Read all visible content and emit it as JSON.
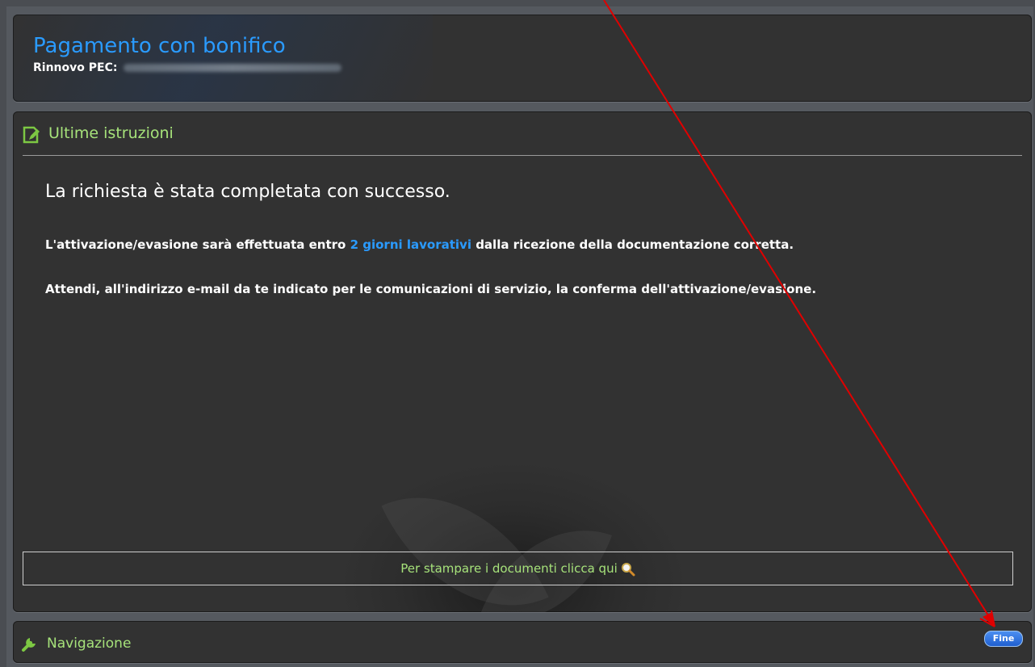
{
  "header": {
    "title": "Pagamento con bonifico",
    "subtitle_label": "Rinnovo PEC:"
  },
  "main": {
    "section_title": "Ultime istruzioni",
    "message_title": "La richiesta è stata completata con successo.",
    "line1_before": "L'attivazione/evasione sarà effettuata entro ",
    "line1_highlight": "2 giorni lavorativi",
    "line1_after": " dalla ricezione della documentazione corretta.",
    "line2": "Attendi, all'indirizzo e-mail da te indicato per le comunicazioni di servizio, la conferma dell'attivazione/evasione.",
    "print_link": "Per stampare i documenti clicca qui"
  },
  "nav": {
    "section_title": "Navigazione",
    "finish_button": "Fine"
  },
  "colors": {
    "accent_blue": "#2a9bff",
    "accent_green": "#a6e27a",
    "panel_bg": "#323232",
    "annotation_red": "#e00000"
  },
  "icons": {
    "section": "edit-document-icon",
    "print": "magnifier-icon",
    "nav": "wrench-icon"
  }
}
